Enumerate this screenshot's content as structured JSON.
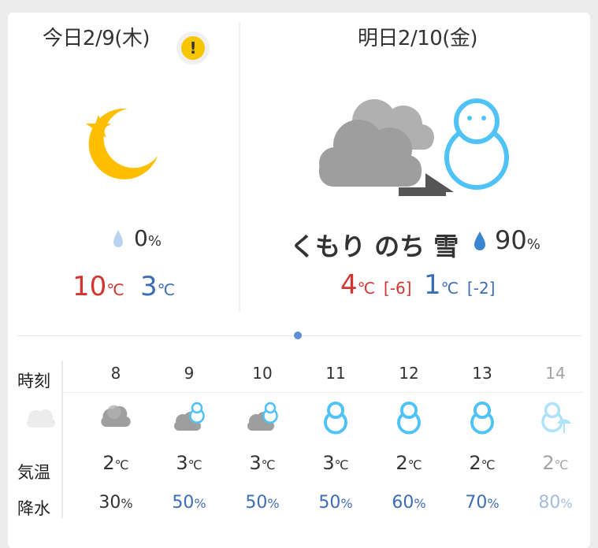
{
  "today": {
    "title": "今日2/9(木)",
    "alert_symbol": "!",
    "icon": "moon-star-icon",
    "pop": "0",
    "pop_unit": "%",
    "high": "10",
    "low": "3",
    "unit": "℃"
  },
  "tomorrow": {
    "title": "明日2/10(金)",
    "icon": "cloudy-then-snow-icon",
    "weather": "くもり のち 雪",
    "pop": "90",
    "pop_unit": "%",
    "high": "4",
    "high_diff": "[-6]",
    "low": "1",
    "low_diff": "[-2]",
    "unit": "℃"
  },
  "hourly": {
    "labels": {
      "time": "時刻",
      "temp": "気温",
      "precip": "降水"
    },
    "unit": "℃",
    "pop_unit": "%",
    "columns": [
      {
        "hour": "8",
        "icon": "cloud-icon",
        "temp": "2",
        "pop": "30"
      },
      {
        "hour": "9",
        "icon": "cloud-snow-icon",
        "temp": "3",
        "pop": "50"
      },
      {
        "hour": "10",
        "icon": "cloud-snow-icon",
        "temp": "3",
        "pop": "50"
      },
      {
        "hour": "11",
        "icon": "snowman-icon",
        "temp": "3",
        "pop": "50"
      },
      {
        "hour": "12",
        "icon": "snowman-icon",
        "temp": "2",
        "pop": "60"
      },
      {
        "hour": "13",
        "icon": "snowman-icon",
        "temp": "2",
        "pop": "70"
      },
      {
        "hour": "14",
        "icon": "snowman-umbrella-icon",
        "temp": "2",
        "pop": "80"
      }
    ]
  },
  "colors": {
    "red": "#d3342f",
    "blue": "#3d6db6",
    "snow": "#4fc3f7",
    "cloud": "#9e9e9e",
    "moon": "#ffbf00"
  }
}
